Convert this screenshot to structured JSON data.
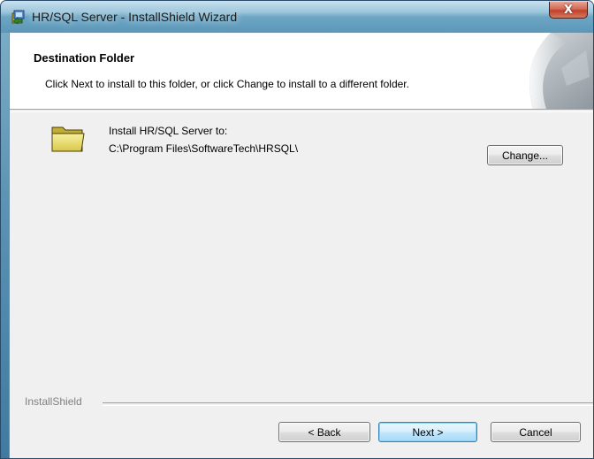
{
  "window": {
    "title": "HR/SQL Server - InstallShield Wizard",
    "close_label": "X"
  },
  "header": {
    "title": "Destination Folder",
    "description": "Click Next to install to this folder, or click Change to install to a different folder."
  },
  "body": {
    "folder_icon": "folder-icon",
    "install_label": "Install HR/SQL Server to:",
    "install_path": "C:\\Program Files\\SoftwareTech\\HRSQL\\",
    "change_label": "Change..."
  },
  "footer": {
    "brand": "InstallShield",
    "back_label": "< Back",
    "next_label": "Next >",
    "cancel_label": "Cancel"
  },
  "colors": {
    "default_button_border": "#3c7fb1",
    "client_background": "#f0f0f0",
    "header_background": "#ffffff"
  }
}
